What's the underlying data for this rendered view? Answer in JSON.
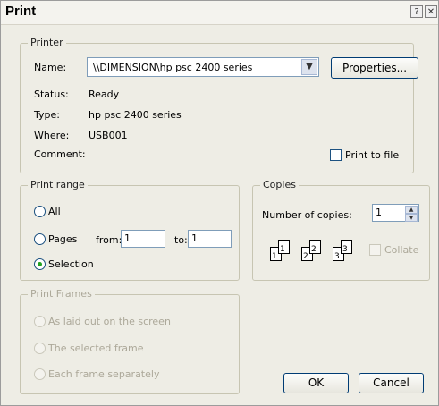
{
  "window": {
    "title": "Print",
    "help_button": "?",
    "close_button": "✕"
  },
  "printer": {
    "legend": "Printer",
    "name_label": "Name:",
    "name_value": "\\\\DIMENSION\\hp psc 2400 series",
    "properties_button": "Properties...",
    "status_label": "Status:",
    "status_value": "Ready",
    "type_label": "Type:",
    "type_value": "hp psc 2400 series",
    "where_label": "Where:",
    "where_value": "USB001",
    "comment_label": "Comment:",
    "print_to_file_label": "Print to file",
    "print_to_file_checked": false
  },
  "print_range": {
    "legend": "Print range",
    "all_label": "All",
    "pages_label": "Pages",
    "from_label": "from:",
    "from_value": "1",
    "to_label": "to:",
    "to_value": "1",
    "selection_label": "Selection",
    "selected": "Selection"
  },
  "copies": {
    "legend": "Copies",
    "number_label": "Number of copies:",
    "number_value": "1",
    "collate_label": "Collate",
    "collate_checked": false,
    "page_icons": [
      "1",
      "1",
      "2",
      "2",
      "3",
      "3"
    ]
  },
  "print_frames": {
    "legend": "Print Frames",
    "option1": "As laid out on the screen",
    "option2": "The selected frame",
    "option3": "Each frame separately"
  },
  "buttons": {
    "ok": "OK",
    "cancel": "Cancel"
  }
}
